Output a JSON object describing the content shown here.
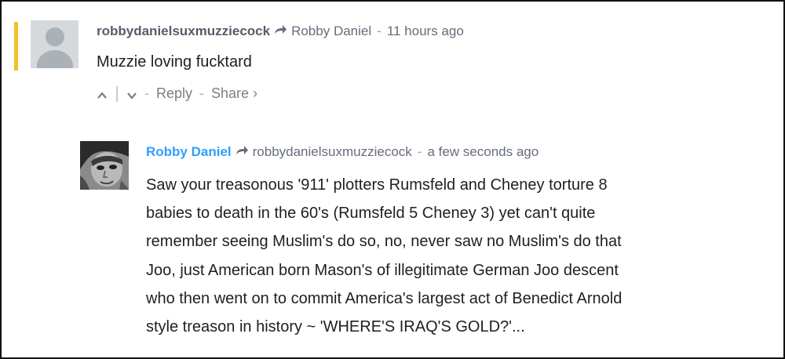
{
  "comment1": {
    "author": "robbydanielsuxmuzziecock",
    "reply_to": "Robby Daniel",
    "timestamp": "11 hours ago",
    "text": "Muzzie loving fucktard",
    "actions": {
      "reply_label": "Reply",
      "share_label": "Share ›"
    }
  },
  "comment2": {
    "author": "Robby Daniel",
    "reply_to": "robbydanielsuxmuzziecock",
    "timestamp": "a few seconds ago",
    "text_lines": [
      "Saw your treasonous '911' plotters Rumsfeld and Cheney torture 8",
      "babies to death in the 60's (Rumsfeld 5 Cheney 3) yet can't quite",
      "remember seeing Muslim's do so, no, never saw no Muslim's do that",
      "Joo, just American born Mason's of illegitimate German Joo descent",
      "who then went on to commit America's largest act of Benedict Arnold",
      "style treason in history ~ 'WHERE'S IRAQ'S GOLD?'..."
    ]
  },
  "colors": {
    "accent_bar": "#f5c026",
    "author_link": "#2e9fff",
    "meta_gray": "#656c7a"
  },
  "icons": {
    "reply_arrow": "reply-arrow-icon",
    "upvote": "chevron-up-icon",
    "downvote": "chevron-down-icon"
  }
}
